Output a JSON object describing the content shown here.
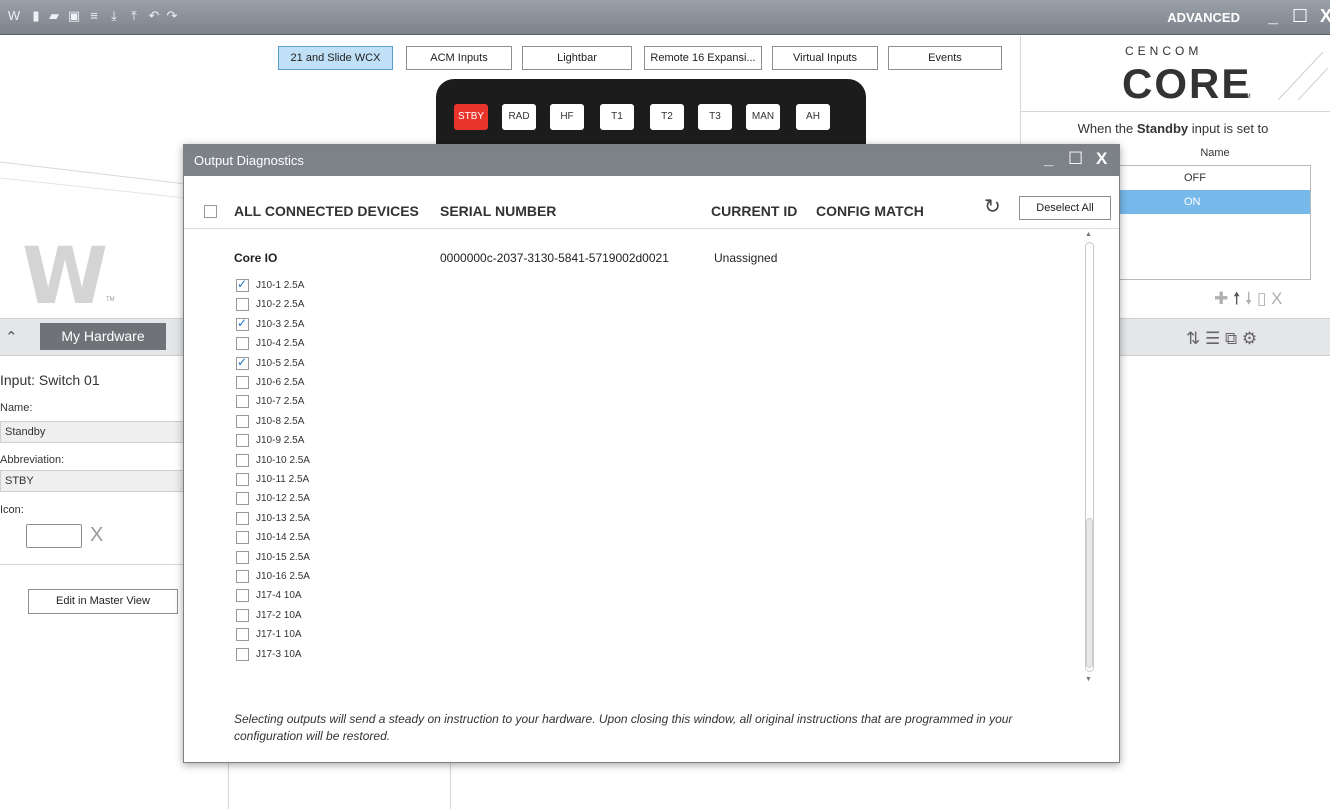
{
  "titlebar": {
    "mode": "ADVANCED",
    "icons": [
      "app-icon",
      "new-icon",
      "open-icon",
      "save-icon",
      "print-icon",
      "download-icon",
      "upload-icon",
      "undo-icon",
      "redo-icon"
    ]
  },
  "top_tabs": [
    {
      "label": "21 and Slide WCX",
      "active": true
    },
    {
      "label": "ACM Inputs",
      "active": false
    },
    {
      "label": "Lightbar",
      "active": false
    },
    {
      "label": "Remote 16 Expansi...",
      "active": false
    },
    {
      "label": "Virtual Inputs",
      "active": false
    },
    {
      "label": "Events",
      "active": false
    }
  ],
  "lightbar_buttons": [
    {
      "label": "STBY",
      "active": true
    },
    {
      "label": "RAD",
      "active": false
    },
    {
      "label": "HF",
      "active": false
    },
    {
      "label": "T1",
      "active": false
    },
    {
      "label": "T2",
      "active": false
    },
    {
      "label": "T3",
      "active": false
    },
    {
      "label": "MAN",
      "active": false
    },
    {
      "label": "AH",
      "active": false
    }
  ],
  "brand": {
    "small": "CENCOM",
    "big": "CORE",
    "tm": "TM"
  },
  "right_panel": {
    "when_prefix": "When the",
    "when_bold": "Standby",
    "when_suffix": "input is set to",
    "table_header": "Name",
    "rows": [
      {
        "label": "OFF",
        "selected": false
      },
      {
        "label": "ON",
        "selected": true
      }
    ]
  },
  "left_panel": {
    "hardware_button": "My Hardware",
    "input_title": "Input: Switch 01",
    "name_label": "Name:",
    "name_value": "Standby",
    "abbrev_label": "Abbreviation:",
    "abbrev_value": "STBY",
    "icon_label": "Icon:",
    "clear_icon": "X",
    "edit_button": "Edit in Master View"
  },
  "dialog": {
    "title": "Output Diagnostics",
    "headers": {
      "devices": "ALL CONNECTED DEVICES",
      "serial": "SERIAL NUMBER",
      "current_id": "CURRENT ID",
      "config_match": "CONFIG MATCH"
    },
    "deselect_all": "Deselect All",
    "device": {
      "name": "Core IO",
      "serial": "0000000c-2037-3130-5841-5719002d0021",
      "current_id": "Unassigned"
    },
    "outputs": [
      {
        "label": "J10-1 2.5A",
        "checked": true
      },
      {
        "label": "J10-2 2.5A",
        "checked": false
      },
      {
        "label": "J10-3 2.5A",
        "checked": true
      },
      {
        "label": "J10-4 2.5A",
        "checked": false
      },
      {
        "label": "J10-5 2.5A",
        "checked": true
      },
      {
        "label": "J10-6 2.5A",
        "checked": false
      },
      {
        "label": "J10-7 2.5A",
        "checked": false
      },
      {
        "label": "J10-8 2.5A",
        "checked": false
      },
      {
        "label": "J10-9 2.5A",
        "checked": false
      },
      {
        "label": "J10-10 2.5A",
        "checked": false
      },
      {
        "label": "J10-11 2.5A",
        "checked": false
      },
      {
        "label": "J10-12 2.5A",
        "checked": false
      },
      {
        "label": "J10-13 2.5A",
        "checked": false
      },
      {
        "label": "J10-14 2.5A",
        "checked": false
      },
      {
        "label": "J10-15 2.5A",
        "checked": false
      },
      {
        "label": "J10-16 2.5A",
        "checked": false
      },
      {
        "label": "J17-4 10A",
        "checked": false
      },
      {
        "label": "J17-2 10A",
        "checked": false
      },
      {
        "label": "J17-1 10A",
        "checked": false
      },
      {
        "label": "J17-3 10A",
        "checked": false
      }
    ],
    "note": "Selecting outputs will send a steady on instruction to your hardware. Upon closing this window, all original instructions that are programmed in your configuration will be restored."
  },
  "colors": {
    "accent": "#e8342a",
    "selection": "#78b9ec",
    "titlebar": "#7d8289"
  }
}
